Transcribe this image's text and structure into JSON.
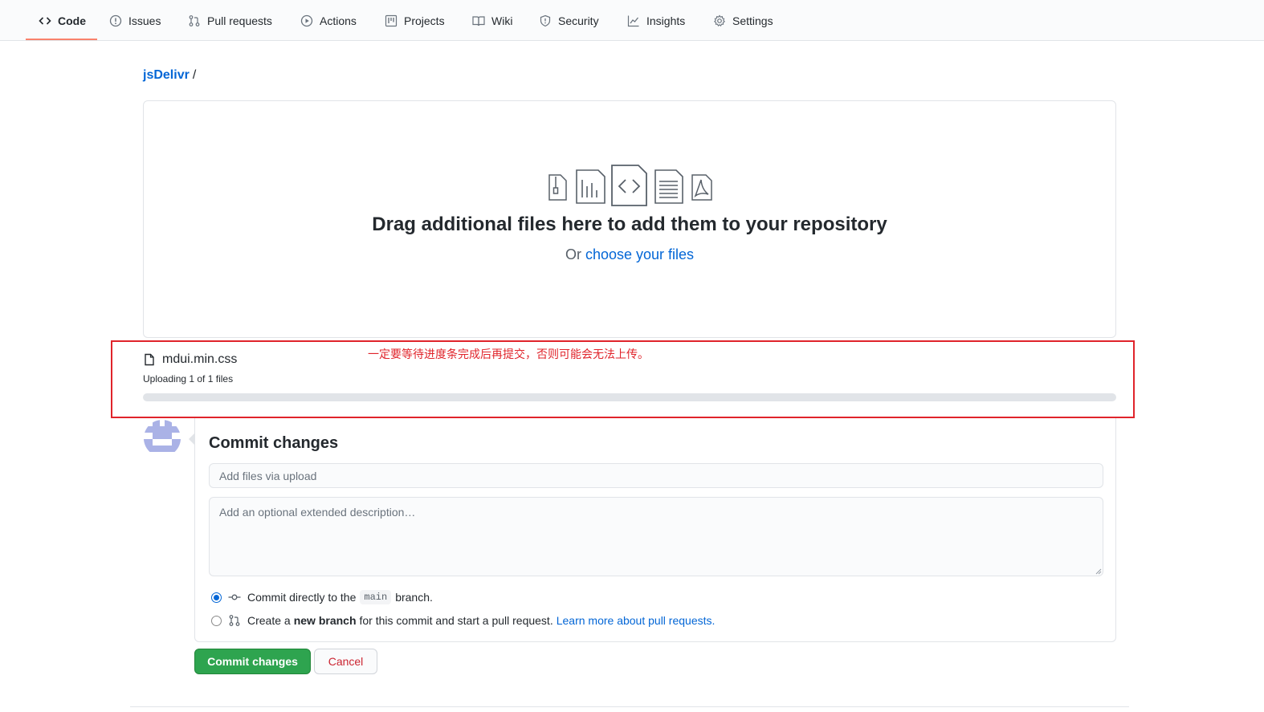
{
  "nav": {
    "tabs": [
      {
        "label": "Code",
        "icon": "code-icon"
      },
      {
        "label": "Issues",
        "icon": "issue-opened-icon"
      },
      {
        "label": "Pull requests",
        "icon": "git-pull-request-icon"
      },
      {
        "label": "Actions",
        "icon": "play-icon"
      },
      {
        "label": "Projects",
        "icon": "project-icon"
      },
      {
        "label": "Wiki",
        "icon": "book-icon"
      },
      {
        "label": "Security",
        "icon": "shield-icon"
      },
      {
        "label": "Insights",
        "icon": "graph-icon"
      },
      {
        "label": "Settings",
        "icon": "gear-icon"
      }
    ],
    "selected": "Code"
  },
  "breadcrumb": {
    "repo": "jsDelivr",
    "separator": "/"
  },
  "dropzone": {
    "title": "Drag additional files here to add them to your repository",
    "prefix": "Or",
    "link": "choose your files"
  },
  "upload": {
    "filename": "mdui.min.css",
    "status": "Uploading 1 of 1 files",
    "progress_fraction": 0
  },
  "annotation": {
    "text": "一定要等待进度条完成后再提交，否则可能会无法上传。",
    "color": "#e0242b"
  },
  "commit": {
    "title": "Commit changes",
    "summary_placeholder": "Add files via upload",
    "description_placeholder": "Add an optional extended description…",
    "option_direct": {
      "prefix": "Commit directly to the",
      "branch": "main",
      "suffix": "branch."
    },
    "option_new": {
      "prefix": "Create a",
      "bold": "new branch",
      "suffix": "for this commit and start a pull request.",
      "link": "Learn more about pull requests."
    },
    "submit_label": "Commit changes",
    "cancel_label": "Cancel"
  },
  "colors": {
    "accent_link": "#0366d6",
    "primary_button": "#2ea44f",
    "danger_text": "#cb2431",
    "tab_underline": "#f9826c"
  }
}
